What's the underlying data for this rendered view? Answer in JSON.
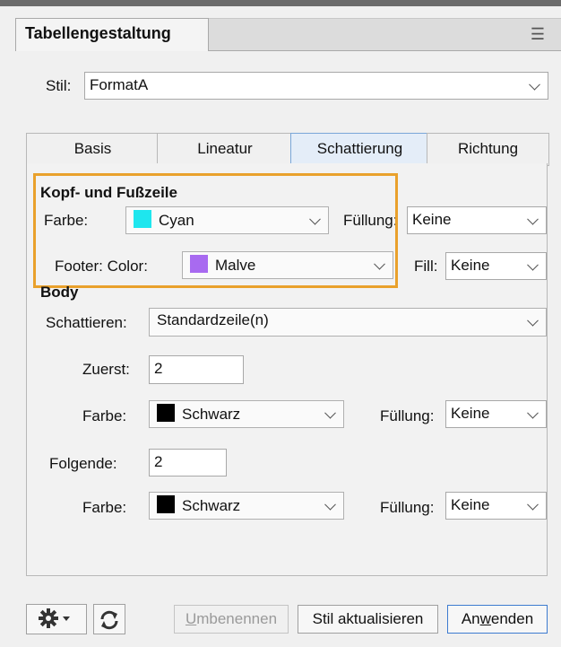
{
  "panel": {
    "title": "Tabellengestaltung",
    "menu_icon": "hamburger-menu-icon"
  },
  "style": {
    "label": "Stil:",
    "value": "FormatA"
  },
  "tabs": [
    {
      "label": "Basis"
    },
    {
      "label": "Lineatur"
    },
    {
      "label": "Schattierung",
      "active": true
    },
    {
      "label": "Richtung"
    }
  ],
  "header_footer": {
    "title": "Kopf- und Fußzeile",
    "color_label": "Farbe:",
    "color_value": "Cyan",
    "color_swatch": "#1ee6ee",
    "fill_label": "Füllung:",
    "fill_value": "Keine",
    "footer_color_label": "Footer: Color:",
    "footer_color_value": "Malve",
    "footer_swatch": "#a86af0",
    "footer_fill_label": "Fill:",
    "footer_fill_value": "Keine"
  },
  "body": {
    "title": "Body",
    "shade_label": "Schattieren:",
    "shade_value": "Standardzeile(n)",
    "first_label": "Zuerst:",
    "first_value": "2",
    "first_color_label": "Farbe:",
    "first_color_value": "Schwarz",
    "first_fill_label": "Füllung:",
    "first_fill_value": "Keine",
    "next_label": "Folgende:",
    "next_value": "2",
    "next_color_label": "Farbe:",
    "next_color_value": "Schwarz",
    "next_fill_label": "Füllung:",
    "next_fill_value": "Keine",
    "swatch_color": "#000000"
  },
  "footer": {
    "gear_icon": "gear-icon",
    "refresh_icon": "refresh-icon",
    "rename_u": "U",
    "rename_rest": "mbenennen",
    "update_label": "Stil aktualisieren",
    "apply_pre": "An",
    "apply_u": "w",
    "apply_post": "enden"
  }
}
